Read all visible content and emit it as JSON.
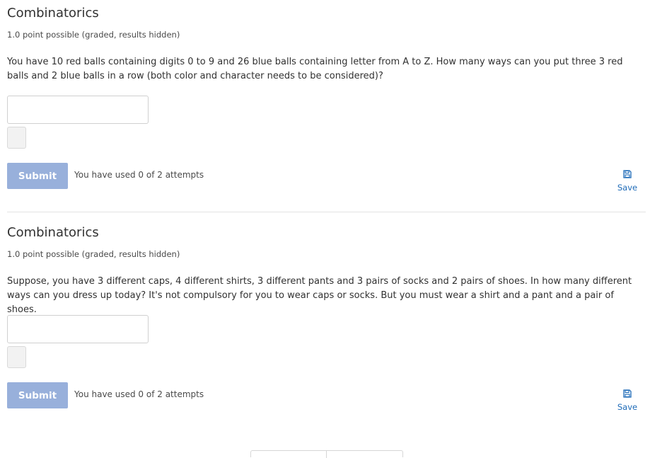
{
  "problems": [
    {
      "title": "Combinatorics",
      "meta": "1.0 point possible (graded, results hidden)",
      "question": "You have 10 red balls containing digits 0 to 9 and 26 blue balls containing letter from A to Z. How many ways can you put three 3 red balls and 2 blue balls in a row (both color and character needs to be considered)?",
      "answer_value": "",
      "submit_label": "Submit",
      "attempts_text": "You have used 0 of 2 attempts",
      "save_label": "Save"
    },
    {
      "title": "Combinatorics",
      "meta": "1.0 point possible (graded, results hidden)",
      "question": "Suppose, you have 3 different caps, 4 different shirts, 3 different pants and 3 pairs of socks and 2 pairs of shoes. In how many different ways can you dress up today? It's not compulsory for you to wear caps or socks. But you must wear a shirt and a pant and a pair of shoes.",
      "answer_value": "",
      "submit_label": "Submit",
      "attempts_text": "You have used 0 of 2 attempts",
      "save_label": "Save"
    }
  ],
  "icons": {
    "save": "floppy-disk-icon"
  },
  "colors": {
    "submit_bg": "#98b0db",
    "link": "#1e6bb8",
    "text": "#313131"
  }
}
